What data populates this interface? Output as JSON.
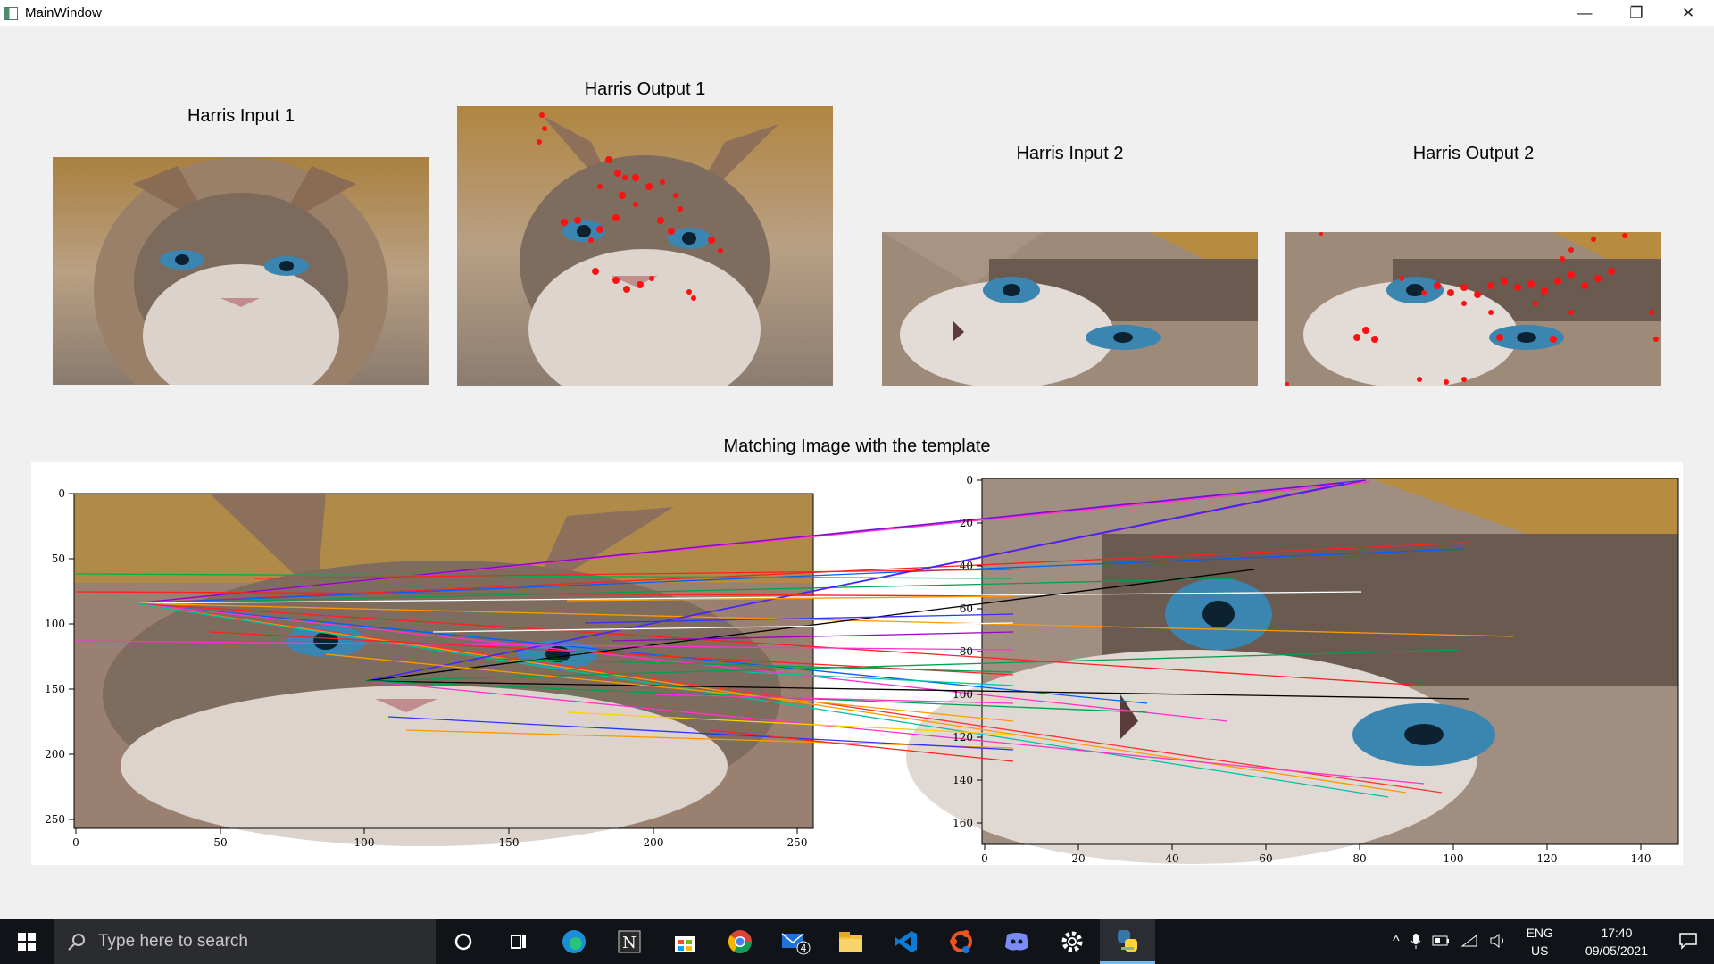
{
  "window": {
    "title": "MainWindow",
    "minimize_glyph": "—",
    "restore_glyph": "❐",
    "close_glyph": "✕"
  },
  "panels": [
    {
      "label": "Harris Input 1",
      "kind": "input"
    },
    {
      "label": "Harris Output 1",
      "kind": "output"
    },
    {
      "label": "Harris Input 2",
      "kind": "input"
    },
    {
      "label": "Harris Output 2",
      "kind": "output"
    }
  ],
  "matching": {
    "label": "Matching Image with the template",
    "left_axes": {
      "y_ticks": [
        "0",
        "50",
        "100",
        "150",
        "200",
        "250"
      ],
      "x_ticks": [
        "0",
        "50",
        "100",
        "150",
        "200",
        "250"
      ]
    },
    "right_axes": {
      "y_ticks": [
        "0",
        "20",
        "40",
        "60",
        "80",
        "100",
        "120",
        "140",
        "160"
      ],
      "x_ticks": [
        "0",
        "20",
        "40",
        "60",
        "80",
        "100",
        "120",
        "140"
      ]
    }
  },
  "taskbar": {
    "search_placeholder": "Type here to search",
    "apps": [
      "cortana-icon",
      "task-view-icon",
      "edge-icon",
      "notion-icon",
      "store-icon",
      "chrome-icon",
      "mail-icon",
      "file-explorer-icon",
      "vscode-icon",
      "ubuntu-icon",
      "discord-icon",
      "settings-icon",
      "python-icon"
    ],
    "mail_badge": "4",
    "language": "ENG",
    "region": "US",
    "time": "17:40",
    "date": "09/05/2021"
  },
  "colors": {
    "corner_marker": "#ff1010",
    "titlebar": "#ffffff",
    "taskbar": "#101318"
  }
}
